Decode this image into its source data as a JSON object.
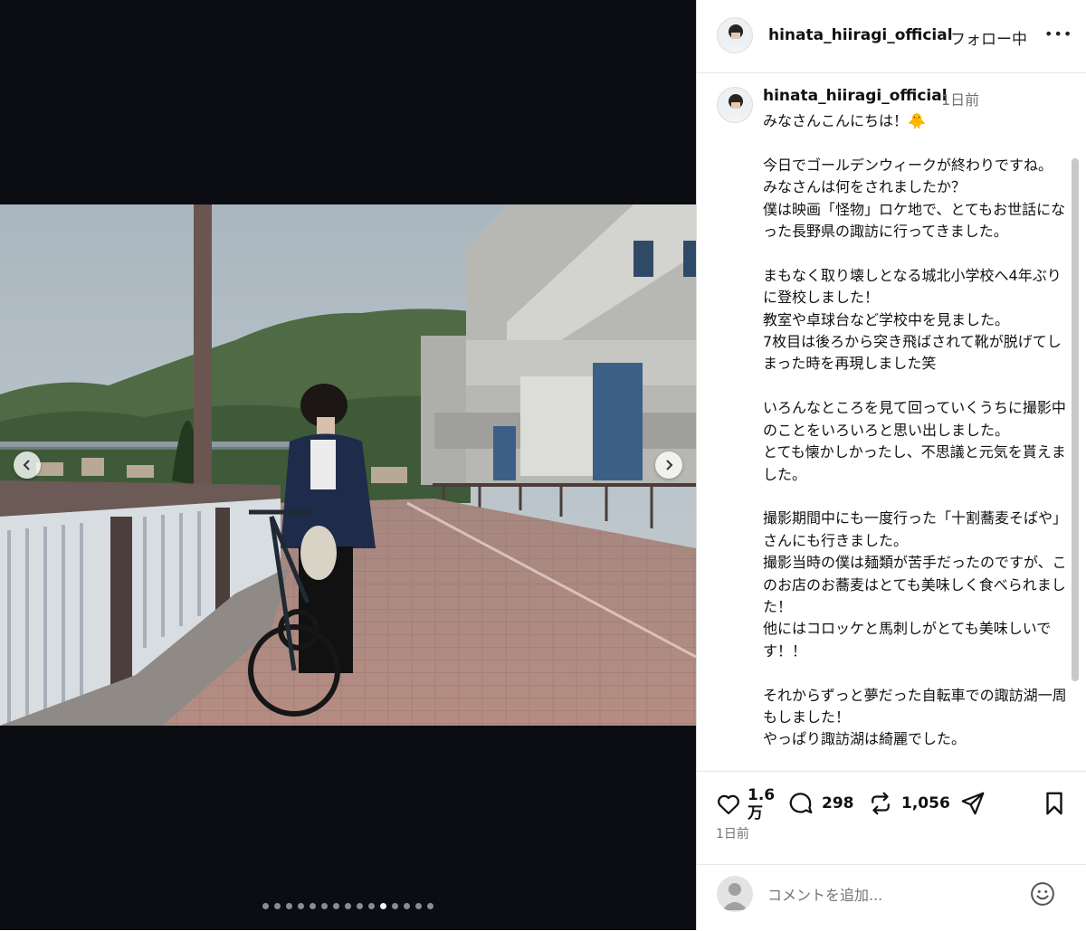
{
  "post": {
    "username": "hinata_hiiragi_official",
    "follow_status": "フォロー中",
    "more_label": "•••"
  },
  "caption": {
    "username": "hinata_hiiragi_official",
    "time": "1日前",
    "text": "みなさんこんにちは！🐥\n\n今日でゴールデンウィークが終わりですね。\nみなさんは何をされましたか？\n僕は映画「怪物」ロケ地で、とてもお世話になった長野県の諏訪に行ってきました。\n\nまもなく取り壊しとなる城北小学校へ4年ぶりに登校しました！\n教室や卓球台など学校中を見ました。\n7枚目は後ろから突き飛ばされて靴が脱げてしまった時を再現しました笑\n\nいろんなところを見て回っていくうちに撮影中のことをいろいろと思い出しました。\nとても懐かしかったし、不思議と元気を貰えました。\n\n撮影期間中にも一度行った「十割蕎麦そばや」さんにも行きました。\n撮影当時の僕は麺類が苦手だったのですが、このお店のお蕎麦はとても美味しく食べられました！\n他にはコロッケと馬刺しがとても美味しいです！！\n\nそれからずっと夢だった自転車での諏訪湖一周もしました！\nやっぱり諏訪湖は綺麗でした。"
  },
  "actions": {
    "likes_line1": "1.6",
    "likes_line2": "万",
    "comments": "298",
    "reposts": "1,056",
    "timestamp": "1日前"
  },
  "comment_input": {
    "placeholder": "コメントを追加..."
  },
  "carousel": {
    "total": 15,
    "current": 11
  },
  "icons": [
    "chevron-left-icon",
    "chevron-right-icon",
    "heart-icon",
    "comment-icon",
    "repost-icon",
    "share-icon",
    "bookmark-icon",
    "emoji-icon",
    "more-icon"
  ],
  "colors": {
    "media_bg": "#0b0d12",
    "text": "#111111",
    "muted": "#737373",
    "divider": "#e6e6e6"
  }
}
